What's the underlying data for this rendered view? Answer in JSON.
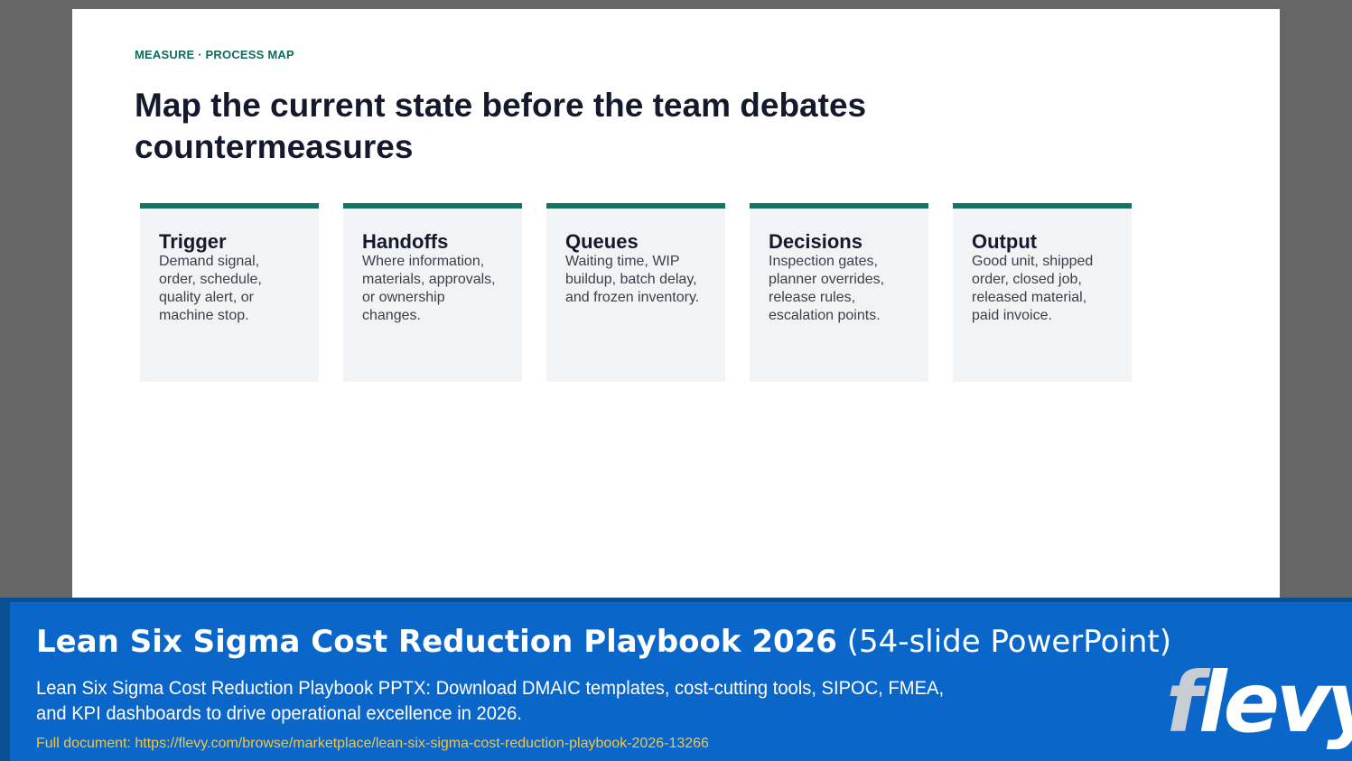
{
  "slide": {
    "eyebrow": "MEASURE · PROCESS MAP",
    "title": "Map the current state before the team debates countermeasures",
    "cards": [
      {
        "title": "Trigger",
        "body": "Demand signal, order, schedule, quality alert, or machine stop."
      },
      {
        "title": "Handoffs",
        "body": "Where information, materials, approvals, or ownership changes."
      },
      {
        "title": "Queues",
        "body": "Waiting time, WIP buildup, batch delay, and frozen inventory."
      },
      {
        "title": "Decisions",
        "body": "Inspection gates, planner overrides, release rules, escalation points."
      },
      {
        "title": "Output",
        "body": "Good unit, shipped order, closed job, released material, paid invoice."
      }
    ]
  },
  "banner": {
    "title_strong": "Lean Six Sigma Cost Reduction Playbook 2026",
    "title_light": "(54-slide PowerPoint)",
    "description": "Lean Six Sigma Cost Reduction Playbook PPTX: Download DMAIC templates, cost-cutting tools, SIPOC, FMEA, and KPI dashboards to drive operational excellence in 2026.",
    "link": "Full document: https://flevy.com/browse/marketplace/lean-six-sigma-cost-reduction-playbook-2026-13266",
    "logo_first": "f",
    "logo_rest": "levy"
  },
  "colors": {
    "accent": "#137565",
    "banner": "#0a67c9",
    "link": "#f2c642"
  }
}
